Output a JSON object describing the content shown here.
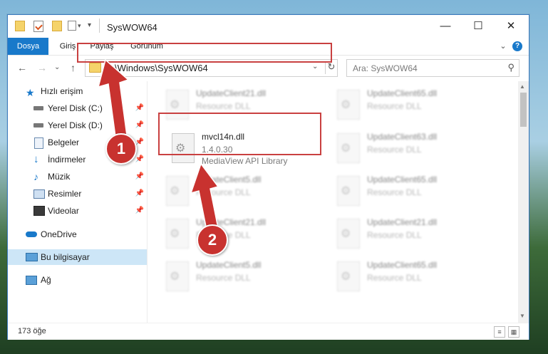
{
  "window": {
    "title": "SysWOW64",
    "controls": {
      "minimize": "—",
      "maximize": "☐",
      "close": "✕"
    }
  },
  "ribbon": {
    "tabs": [
      "Dosya",
      "Giriş",
      "Paylaş",
      "Görünüm"
    ],
    "expand_icon": "⌄",
    "help_icon": "?"
  },
  "address": {
    "path": "C:\\Windows\\SysWOW64",
    "dropdown": "⌄",
    "refresh": "↻"
  },
  "search": {
    "placeholder": "Ara: SysWOW64",
    "icon": "⚲"
  },
  "nav": {
    "back": "←",
    "forward": "→",
    "recent": "⌄",
    "up": "↑",
    "items": [
      {
        "label": "Hızlı erişim",
        "icon": "star-icon"
      },
      {
        "label": "Yerel Disk (C:)",
        "icon": "drive-icon",
        "pinned": true
      },
      {
        "label": "Yerel Disk (D:)",
        "icon": "drive-icon",
        "pinned": true
      },
      {
        "label": "Belgeler",
        "icon": "documents-icon",
        "pinned": true
      },
      {
        "label": "İndirmeler",
        "icon": "download-icon",
        "pinned": true
      },
      {
        "label": "Müzik",
        "icon": "music-icon",
        "pinned": true
      },
      {
        "label": "Resimler",
        "icon": "pictures-icon",
        "pinned": true
      },
      {
        "label": "Videolar",
        "icon": "videos-icon",
        "pinned": true
      },
      {
        "label": "OneDrive",
        "icon": "cloud-icon"
      },
      {
        "label": "Bu bilgisayar",
        "icon": "computer-icon",
        "selected": true
      },
      {
        "label": "Ağ",
        "icon": "network-icon"
      }
    ],
    "pin_glyph": "📌"
  },
  "files": {
    "highlighted": {
      "name": "mvcl14n.dll",
      "version": "1.4.0.30",
      "description": "MediaView API Library"
    },
    "blurred": [
      {
        "name": "UpdateClient21.dll",
        "type": "Resource DLL"
      },
      {
        "name": "UpdateClient65.dll",
        "type": "Resource DLL"
      },
      {
        "name": "UpdateClient63.dll",
        "type": "Resource DLL"
      },
      {
        "name": "UpdateClient5.dll",
        "type": "Resource DLL"
      },
      {
        "name": "UpdateClient65.dll",
        "type": "Resource DLL"
      },
      {
        "name": "UpdateClient21.dll",
        "type": "Resource DLL"
      },
      {
        "name": "UpdateClient21.dll",
        "type": "Resource DLL"
      },
      {
        "name": "UpdateClient5.dll",
        "type": "Resource DLL"
      },
      {
        "name": "UpdateClient65.dll",
        "type": "Resource DLL"
      }
    ]
  },
  "status": {
    "item_count": "173 öğe"
  },
  "annotations": {
    "step1": "1",
    "step2": "2",
    "color": "#c8322f"
  }
}
